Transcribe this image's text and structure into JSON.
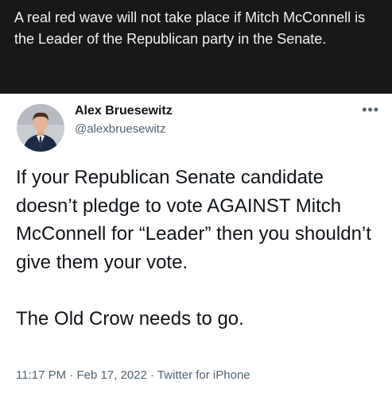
{
  "caption": {
    "text": "A real red wave will not take place if Mitch McConnell is the Leader of the Republican party in the Senate."
  },
  "tweet": {
    "author_name": "Alex Bruesewitz",
    "author_handle": "@alexbruesewitz",
    "more_icon": "more-dots-icon",
    "body_paragraphs": [
      "If your Republican Senate candidate doesn’t pledge to vote AGAINST Mitch McConnell for “Leader” then you shouldn’t give them your vote.",
      "The Old Crow needs to go."
    ],
    "time": "11:17 PM",
    "separator": " · ",
    "date": "Feb 17, 2022",
    "source": "Twitter for iPhone"
  },
  "colors": {
    "caption_bg": "#17181a",
    "caption_text": "#f1f1f1",
    "tweet_text": "#0f1419",
    "secondary_text": "#536471"
  }
}
